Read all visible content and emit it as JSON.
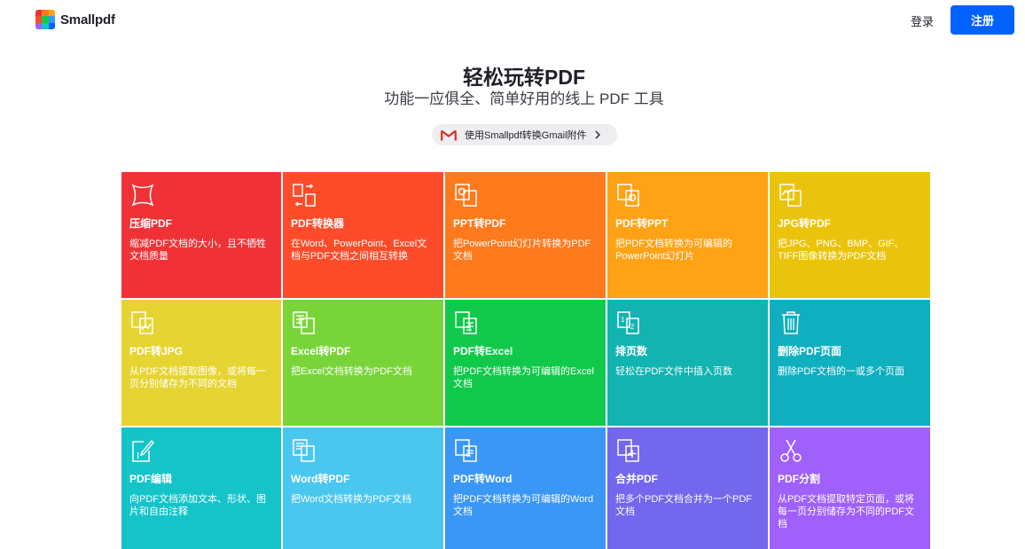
{
  "header": {
    "logo_text": "Smallpdf",
    "login_label": "登录",
    "signup_label": "注册"
  },
  "hero": {
    "title": "轻松玩转PDF",
    "subtitle": "功能一应俱全、简单好用的线上 PDF 工具",
    "gmail_promo": "使用Smallpdf转换Gmail附件"
  },
  "colors": {
    "brand_blue": "#0061fe",
    "compress": "#f03237",
    "pdf_converter": "#fe4c2a",
    "ppt_to_pdf": "#fe7a1d",
    "pdf_to_ppt": "#ffa216",
    "jpg_to_pdf": "#eac30c",
    "pdf_to_jpg": "#e6d432",
    "excel_to_pdf": "#79d43a",
    "pdf_to_excel": "#10c94a",
    "page_numbers": "#12b3b0",
    "delete_pages": "#10afbf",
    "edit_pdf": "#15c4c9",
    "word_to_pdf": "#4ac7ef",
    "pdf_to_word": "#3b97f5",
    "merge_pdf": "#7367ee",
    "split_pdf": "#9f60fb"
  },
  "tools": [
    {
      "icon": "compress-icon",
      "title": "压缩PDF",
      "desc": "缩减PDF文档的大小，且不牺牲文档质量"
    },
    {
      "icon": "convert-icon",
      "title": "PDF转换器",
      "desc": "在Word、PowerPoint、Excel文档与PDF文档之间相互转换"
    },
    {
      "icon": "ppt-to-pdf-icon",
      "title": "PPT转PDF",
      "desc": "把PowerPoint幻灯片转换为PDF文档"
    },
    {
      "icon": "pdf-to-ppt-icon",
      "title": "PDF转PPT",
      "desc": "把PDF文档转换为可编辑的PowerPoint幻灯片"
    },
    {
      "icon": "jpg-to-pdf-icon",
      "title": "JPG转PDF",
      "desc": "把JPG、PNG、BMP、GIF、TIFF图像转换为PDF文档"
    },
    {
      "icon": "pdf-to-jpg-icon",
      "title": "PDF转JPG",
      "desc": "从PDF文档提取图像，或将每一页分别储存为不同的文档"
    },
    {
      "icon": "excel-to-pdf-icon",
      "title": "Excel转PDF",
      "desc": "把Excel文档转换为PDF文档"
    },
    {
      "icon": "pdf-to-excel-icon",
      "title": "PDF转Excel",
      "desc": "把PDF文档转换为可编辑的Excel文档"
    },
    {
      "icon": "page-numbers-icon",
      "title": "排页数",
      "desc": "轻松在PDF文件中插入页数"
    },
    {
      "icon": "trash-icon",
      "title": "删除PDF页面",
      "desc": "删除PDF文档的一或多个页面"
    },
    {
      "icon": "edit-icon",
      "title": "PDF编辑",
      "desc": "向PDF文档添加文本、形状、图片和自由注释"
    },
    {
      "icon": "word-to-pdf-icon",
      "title": "Word转PDF",
      "desc": "把Word文档转换为PDF文档"
    },
    {
      "icon": "pdf-to-word-icon",
      "title": "PDF转Word",
      "desc": "把PDF文档转换为可编辑的Word文档"
    },
    {
      "icon": "merge-icon",
      "title": "合并PDF",
      "desc": "把多个PDF文档合并为一个PDF文档"
    },
    {
      "icon": "scissors-icon",
      "title": "PDF分割",
      "desc": "从PDF文档提取特定页面，或将每一页分别储存为不同的PDF文档"
    }
  ]
}
